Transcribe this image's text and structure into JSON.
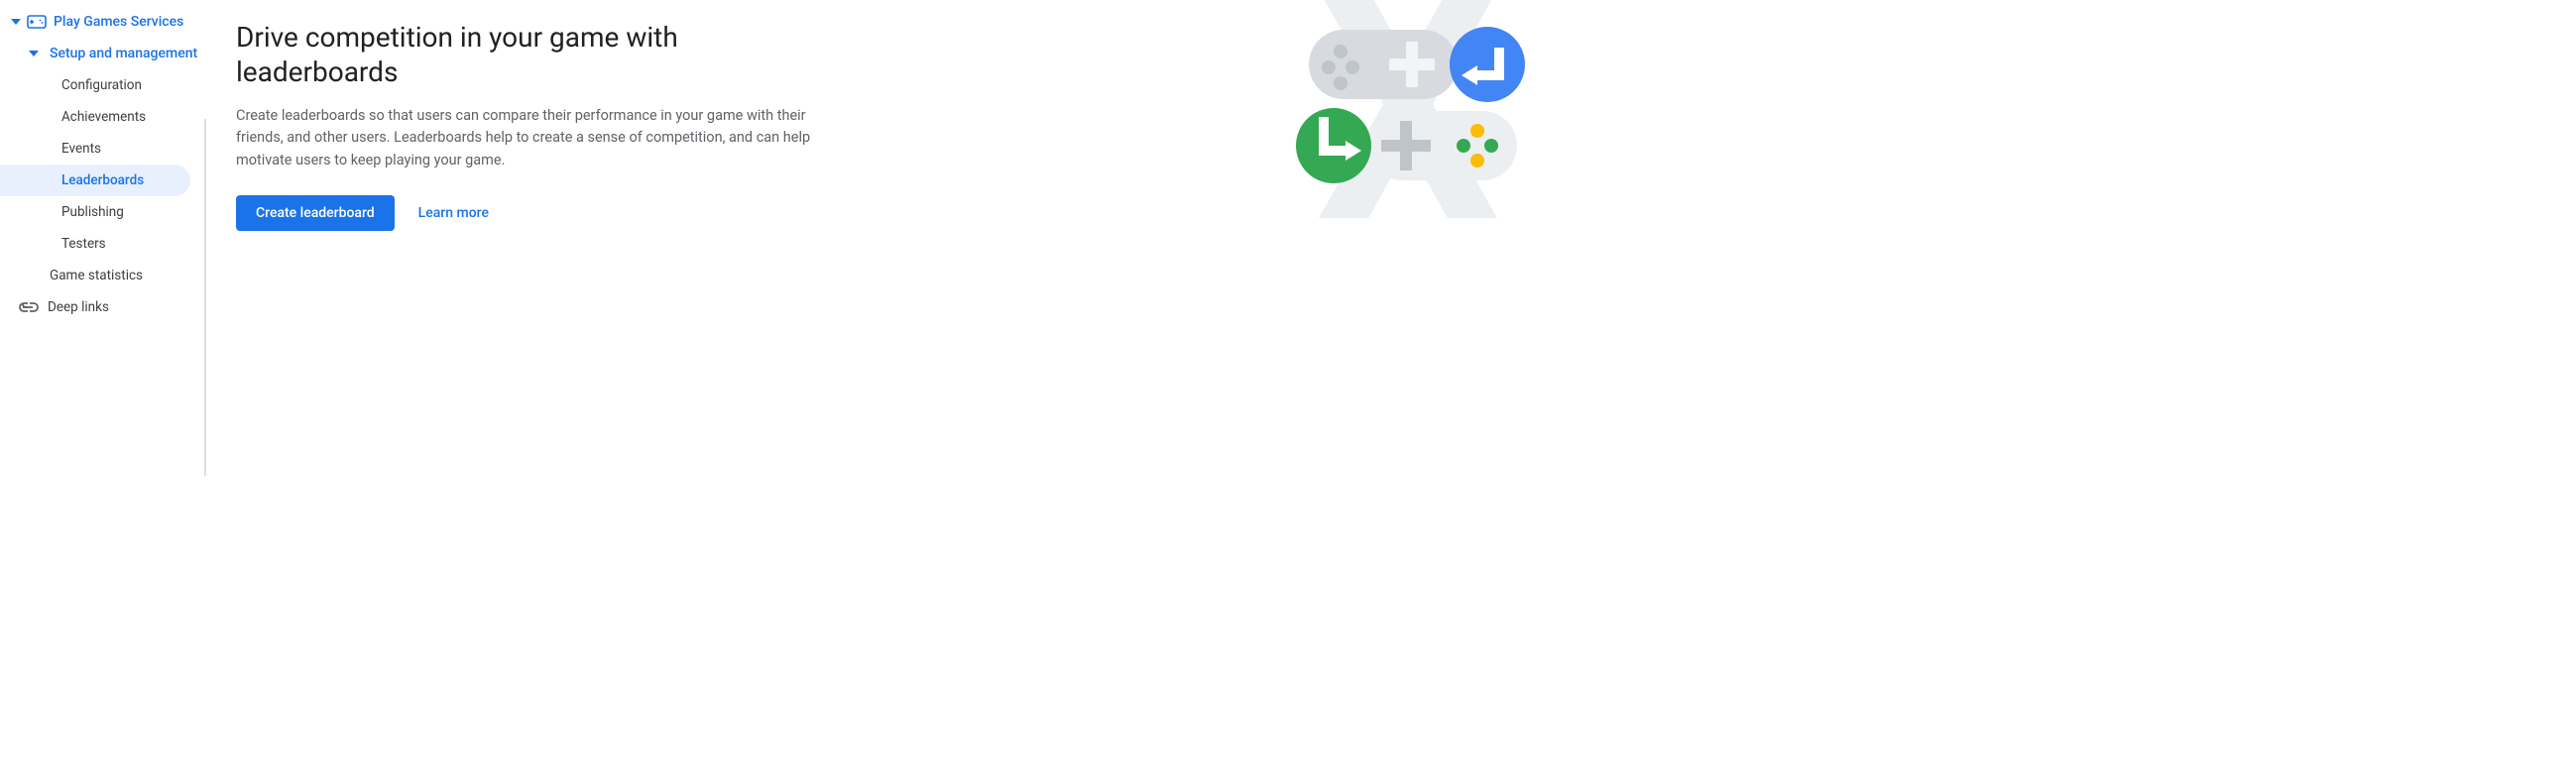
{
  "sidebar": {
    "section": {
      "label": "Play Games Services"
    },
    "subsection": {
      "label": "Setup and management"
    },
    "items": [
      {
        "label": "Configuration"
      },
      {
        "label": "Achievements"
      },
      {
        "label": "Events"
      },
      {
        "label": "Leaderboards"
      },
      {
        "label": "Publishing"
      },
      {
        "label": "Testers"
      }
    ],
    "stats": {
      "label": "Game statistics"
    },
    "deeplinks": {
      "label": "Deep links"
    }
  },
  "main": {
    "heading": "Drive competition in your game with leaderboards",
    "description": "Create leaderboards so that users can compare their performance in your game with their friends, and other users. Leaderboards help to create a sense of competition, and can help motivate users to keep playing your game.",
    "primaryButton": "Create leaderboard",
    "learnMore": "Learn more"
  }
}
